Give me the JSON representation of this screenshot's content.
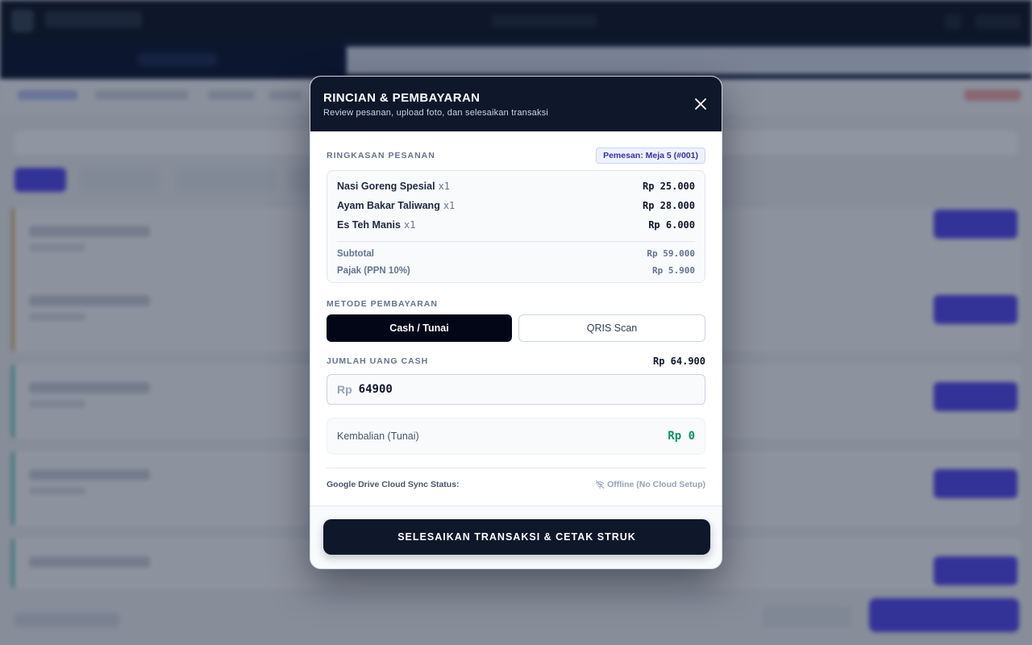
{
  "modal": {
    "title": "RINCIAN & PEMBAYARAN",
    "subtitle": "Review pesanan, upload foto, dan selesaikan transaksi",
    "close_icon": "close-icon"
  },
  "summary": {
    "label": "RINGKASAN PESANAN",
    "badge": "Pemesan: Meja 5 (#001)",
    "items": [
      {
        "name": "Nasi Goreng Spesial",
        "qty": "x1",
        "price": "Rp 25.000"
      },
      {
        "name": "Ayam Bakar Taliwang",
        "qty": "x1",
        "price": "Rp 28.000"
      },
      {
        "name": "Es Teh Manis",
        "qty": "x1",
        "price": "Rp 6.000"
      }
    ],
    "subtotal_label": "Subtotal",
    "subtotal_value": "Rp 59.000",
    "tax_label": "Pajak (PPN 10%)",
    "tax_value": "Rp 5.900"
  },
  "payment": {
    "label": "METODE PEMBAYARAN",
    "methods": [
      "Cash / Tunai",
      "QRIS Scan"
    ],
    "selected": "Cash / Tunai"
  },
  "cash": {
    "label": "JUMLAH UANG CASH",
    "total": "Rp 64.900",
    "prefix": "Rp",
    "value": "64900",
    "change_label": "Kembalian (Tunai)",
    "change_value": "Rp 0"
  },
  "sync": {
    "label": "Google Drive Cloud Sync Status:",
    "status": "Offline (No Cloud Setup)",
    "status_icon": "wifi-off-icon"
  },
  "footer": {
    "finish_label": "SELESAIKAN TRANSAKSI & CETAK STRUK"
  },
  "colors": {
    "header": "#0f172a",
    "accent": "#4f46e5",
    "change": "#059669"
  }
}
